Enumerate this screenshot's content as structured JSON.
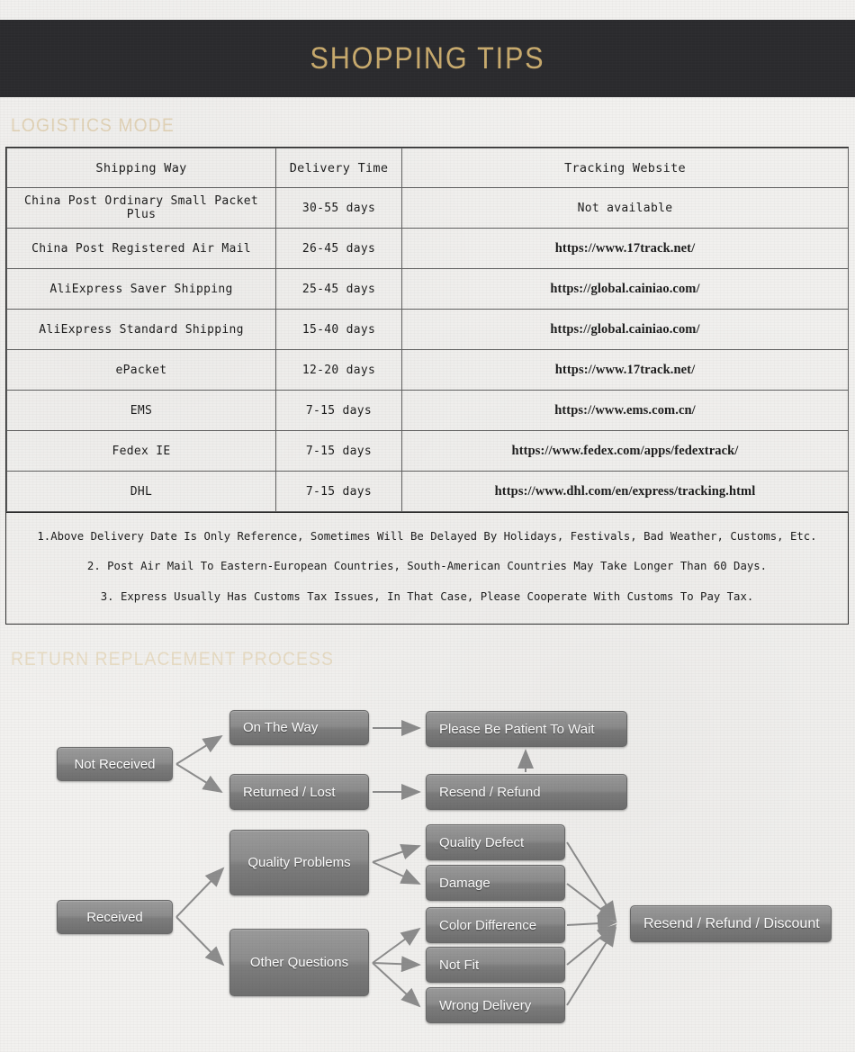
{
  "banner": {
    "title": "SHOPPING TIPS"
  },
  "sections": {
    "logistics_heading": "LOGISTICS MODE",
    "return_heading": "RETURN REPLACEMENT PROCESS"
  },
  "colors": {
    "banner_bg": "#2b2b2e",
    "banner_text": "#c9ab6e",
    "heading_text": "#e3d4b8",
    "page_bg": "#f2f1ef",
    "node_fill_top": "#9b9b9b",
    "node_fill_bottom": "#6f6f6f",
    "node_text": "#ffffff",
    "table_border": "#606060",
    "table_outer_border": "#2f2f2f"
  },
  "logistics_table": {
    "columns": [
      "Shipping Way",
      "Delivery Time",
      "Tracking Website"
    ],
    "rows": [
      {
        "way": "China Post Ordinary Small Packet Plus",
        "time": "30-55 days",
        "site": "Not available",
        "site_style": "plain"
      },
      {
        "way": "China Post Registered Air Mail",
        "time": "26-45 days",
        "site": "https://www.17track.net/",
        "site_style": "url"
      },
      {
        "way": "AliExpress Saver Shipping",
        "time": "25-45 days",
        "site": "https://global.cainiao.com/",
        "site_style": "url"
      },
      {
        "way": "AliExpress Standard Shipping",
        "time": "15-40 days",
        "site": "https://global.cainiao.com/",
        "site_style": "url"
      },
      {
        "way": "ePacket",
        "time": "12-20 days",
        "site": "https://www.17track.net/",
        "site_style": "url"
      },
      {
        "way": "EMS",
        "time": "7-15 days",
        "site": "https://www.ems.com.cn/",
        "site_style": "url"
      },
      {
        "way": "Fedex IE",
        "time": "7-15 days",
        "site": "https://www.fedex.com/apps/fedextrack/",
        "site_style": "url"
      },
      {
        "way": "DHL",
        "time": "7-15 days",
        "site": "https://www.dhl.com/en/express/tracking.html",
        "site_style": "url"
      }
    ]
  },
  "notes": [
    "1.Above Delivery Date Is Only Reference, Sometimes Will Be Delayed By Holidays, Festivals, Bad Weather, Customs, Etc.",
    "2. Post Air Mail To Eastern-European Countries, South-American Countries May Take Longer Than 60 Days.",
    "3. Express Usually Has Customs Tax Issues, In That Case, Please Cooperate With Customs To Pay Tax."
  ],
  "flowchart": {
    "nodes": {
      "not_received": "Not Received",
      "on_the_way": "On The Way",
      "returned_lost": "Returned / Lost",
      "please_wait": "Please Be Patient To Wait",
      "resend_refund": "Resend / Refund",
      "received": "Received",
      "quality_problems": "Quality Problems",
      "other_questions": "Other Questions",
      "quality_defect": "Quality Defect",
      "damage": "Damage",
      "color_difference": "Color Difference",
      "not_fit": "Not Fit",
      "wrong_delivery": "Wrong Delivery",
      "resend_refund_discount": "Resend / Refund / Discount"
    }
  }
}
